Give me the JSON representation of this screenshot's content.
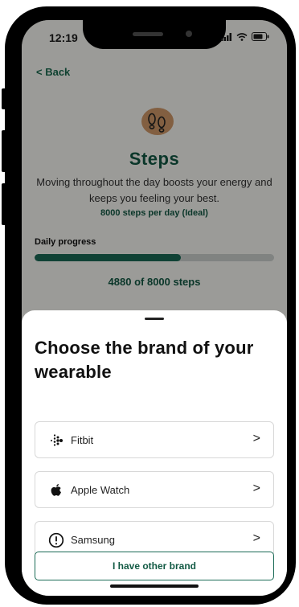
{
  "status_bar": {
    "time": "12:19"
  },
  "header": {
    "back_label": "< Back"
  },
  "steps": {
    "title": "Steps",
    "description": "Moving throughout the day boosts your energy and keeps you feeling your best.",
    "ideal": "8000 steps per day (Ideal)",
    "progress_label": "Daily progress",
    "progress_fraction": 0.61,
    "progress_text": "4880 of 8000 steps"
  },
  "sheet": {
    "title": "Choose the brand of your wearable",
    "options": [
      {
        "label": "Fitbit",
        "icon": "fitbit-logo-icon"
      },
      {
        "label": "Apple Watch",
        "icon": "apple-logo-icon"
      },
      {
        "label": "Samsung",
        "icon": "exclamation-circle-icon"
      }
    ],
    "other_button": "I have other brand"
  },
  "colors": {
    "brand_green": "#125a44",
    "progress_fill": "#1b6b56",
    "icon_bg": "#c47a3a"
  }
}
